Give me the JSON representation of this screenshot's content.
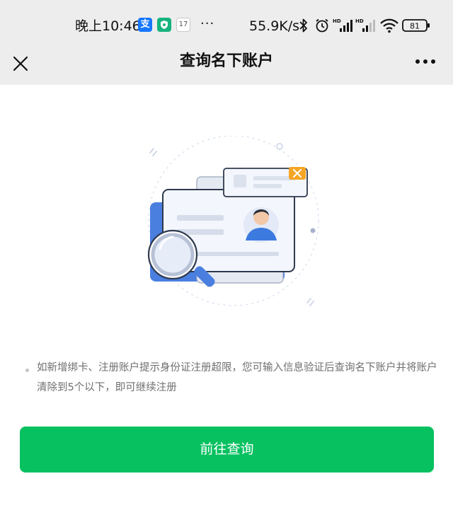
{
  "status_bar": {
    "time": "晚上10:46",
    "net_speed": "55.9K/s",
    "battery": "81",
    "calendar_day": "17",
    "more": "···",
    "alipay_glyph": "支",
    "icons": [
      "alipay-icon",
      "shield-icon",
      "calendar-icon",
      "bluetooth-icon",
      "alarm-icon",
      "signal-hd-icon",
      "signal-hd-icon",
      "wifi-icon",
      "battery-icon"
    ]
  },
  "nav": {
    "title": "查询名下账户",
    "close_icon": "close-icon",
    "more_icon": "more-dots-icon"
  },
  "notice": {
    "text": "如新增绑卡、注册账户提示身份证注册超限，您可输入信息验证后查询名下账户并将账户清除到5个以下，即可继续注册"
  },
  "button": {
    "label": "前往查询"
  },
  "colors": {
    "primary": "#07c160",
    "illustration_blue": "#4a7fe0",
    "badge_orange": "#f5a524"
  }
}
